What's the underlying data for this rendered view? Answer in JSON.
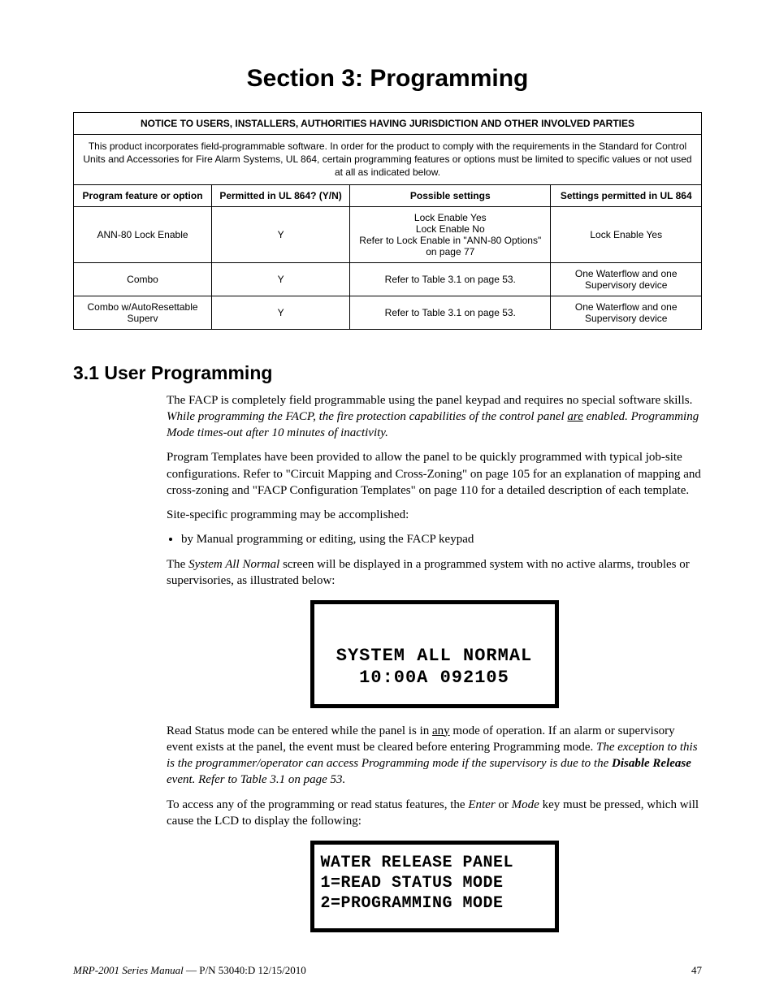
{
  "title": "Section 3: Programming",
  "notice": {
    "caption": "NOTICE TO USERS, INSTALLERS, AUTHORITIES HAVING JURISDICTION AND OTHER INVOLVED PARTIES",
    "intro": "This product incorporates field-programmable software.  In order for the product to comply with the requirements in the Standard for Control Units and Accessories for Fire Alarm Systems, UL 864, certain programming features or options must be limited to specific values or not used at all as indicated below.",
    "columns": {
      "c1": "Program feature or option",
      "c2": "Permitted in UL 864? (Y/N)",
      "c3": "Possible settings",
      "c4": "Settings permitted in UL 864"
    },
    "rows": [
      {
        "feature": "ANN-80 Lock Enable",
        "permitted": "Y",
        "possible": "Lock Enable Yes\nLock Enable No\nRefer to Lock Enable in \"ANN-80 Options\" on page 77",
        "settings": "Lock Enable Yes"
      },
      {
        "feature": "Combo",
        "permitted": "Y",
        "possible": "Refer to Table 3.1 on page 53.",
        "settings": "One Waterflow and one Supervisory device"
      },
      {
        "feature": "Combo w/AutoResettable Superv",
        "permitted": "Y",
        "possible": "Refer to Table 3.1 on page 53.",
        "settings": "One Waterflow and one Supervisory device"
      }
    ]
  },
  "subsection": "3.1  User Programming",
  "para1_a": "The FACP is completely field programmable using the panel keypad and requires no special software skills.  ",
  "para1_b": "While programming the FACP, the fire protection capabilities of the control panel ",
  "para1_u": "are",
  "para1_c": " enabled.  Programming Mode times-out after 10 minutes of inactivity.",
  "para2": "Program Templates have been provided to allow the panel to be quickly programmed with typical job-site configurations.  Refer to \"Circuit Mapping and Cross-Zoning\" on page 105 for an explanation of mapping and cross-zoning and \"FACP Configuration Templates\" on page 110 for a detailed description of each template.",
  "para3": "Site-specific programming may be accomplished:",
  "bullet1": "by Manual programming or editing, using the FACP keypad",
  "para4_a": "The ",
  "para4_b": "System All Normal",
  "para4_c": " screen will be displayed in a programmed system with no active alarms, troubles or supervisories, as illustrated below:",
  "lcd1": "\nSYSTEM ALL NORMAL\n10:00A 092105",
  "para5_a": "Read Status mode can be entered while the panel is in ",
  "para5_u": "any",
  "para5_b": " mode of operation.  If an alarm or supervisory event exists at the panel, the event must be cleared before entering Programming mode.  ",
  "para5_c": "The exception to this is the programmer/operator can access Programming mode if the supervisory is due to the ",
  "para5_d": "Disable Release",
  "para5_e": " event.  Refer to Table 3.1 on page 53.",
  "para6_a": "To access any of the programming or read status features, the ",
  "para6_b": "Enter",
  "para6_c": " or ",
  "para6_d": "Mode",
  "para6_e": " key must be pressed, which will cause the LCD to display the following:",
  "lcd2": "WATER RELEASE PANEL\n1=READ STATUS MODE\n2=PROGRAMMING MODE",
  "footer_left_i": "MRP-2001 Series Manual",
  "footer_left_r": " — P/N 53040:D  12/15/2010",
  "footer_right": "47"
}
